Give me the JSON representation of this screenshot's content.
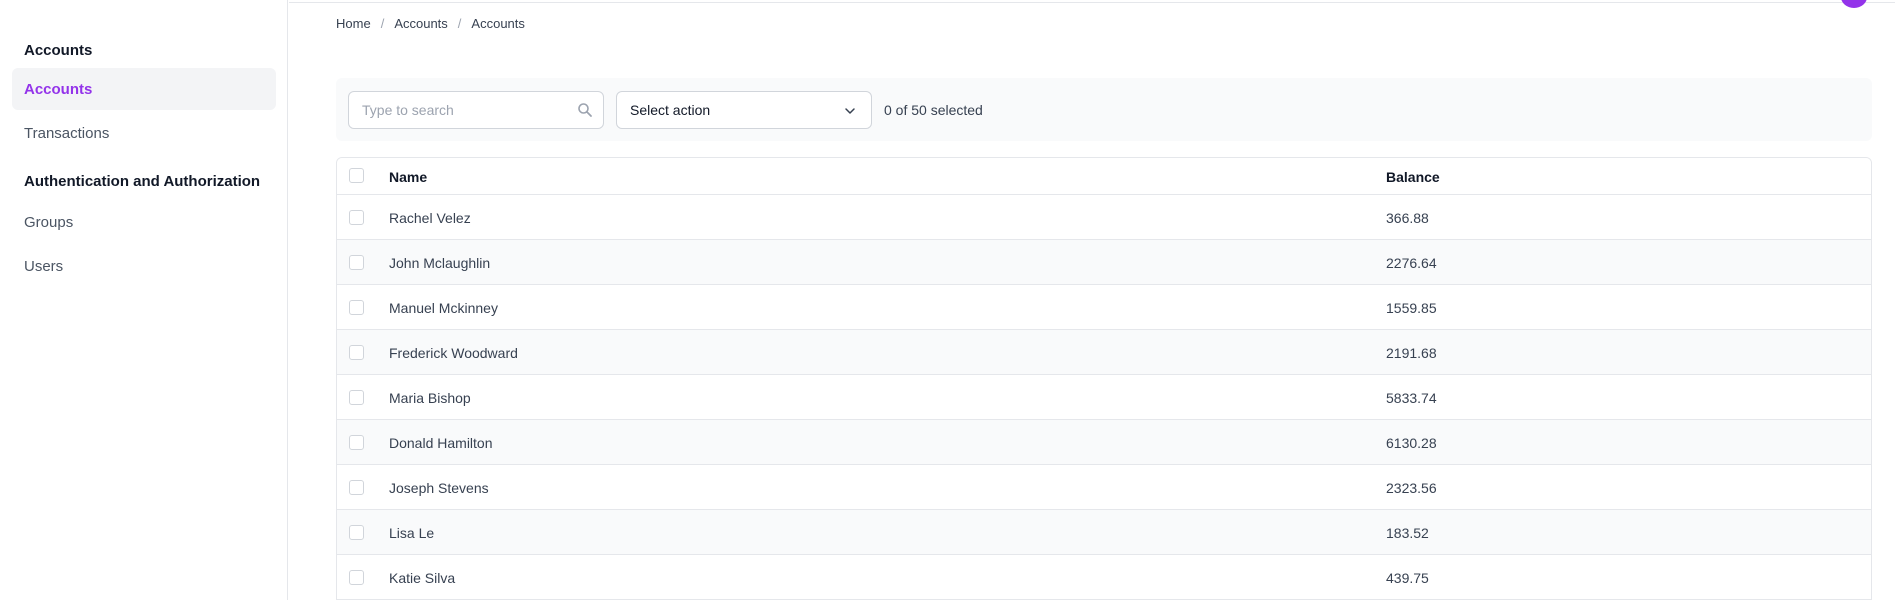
{
  "sidebar": {
    "sections": [
      {
        "title": "Accounts",
        "items": [
          {
            "label": "Accounts",
            "active": true
          },
          {
            "label": "Transactions",
            "active": false
          }
        ]
      },
      {
        "title": "Authentication and Authorization",
        "items": [
          {
            "label": "Groups",
            "active": false
          },
          {
            "label": "Users",
            "active": false
          }
        ]
      }
    ]
  },
  "breadcrumb": [
    "Home",
    "Accounts",
    "Accounts"
  ],
  "toolbar": {
    "search_placeholder": "Type to search",
    "search_value": "",
    "action_select_value": "Select action",
    "selected_count": "0 of 50 selected"
  },
  "table": {
    "columns": [
      "Name",
      "Balance"
    ],
    "rows": [
      {
        "name": "Rachel Velez",
        "balance": "366.88"
      },
      {
        "name": "John Mclaughlin",
        "balance": "2276.64"
      },
      {
        "name": "Manuel Mckinney",
        "balance": "1559.85"
      },
      {
        "name": "Frederick Woodward",
        "balance": "2191.68"
      },
      {
        "name": "Maria Bishop",
        "balance": "5833.74"
      },
      {
        "name": "Donald Hamilton",
        "balance": "6130.28"
      },
      {
        "name": "Joseph Stevens",
        "balance": "2323.56"
      },
      {
        "name": "Lisa Le",
        "balance": "183.52"
      },
      {
        "name": "Katie Silva",
        "balance": "439.75"
      }
    ]
  },
  "icons": {
    "search": "search-icon",
    "dropdown": "chevron-down-icon",
    "avatar": "avatar"
  },
  "colors": {
    "accent": "#9333ea",
    "border": "#e5e7eb",
    "row_alt": "#f9fafb"
  }
}
